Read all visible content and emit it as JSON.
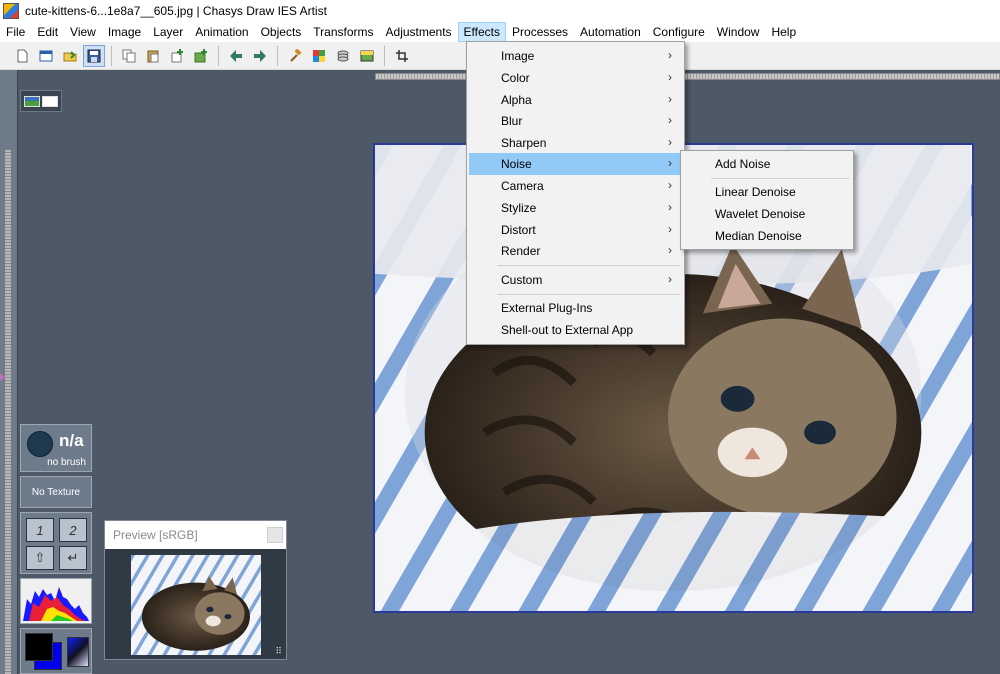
{
  "window": {
    "title": "cute-kittens-6...1e8a7__605.jpg | Chasys Draw IES Artist"
  },
  "menubar": [
    "File",
    "Edit",
    "View",
    "Image",
    "Layer",
    "Animation",
    "Objects",
    "Transforms",
    "Adjustments",
    "Effects",
    "Processes",
    "Automation",
    "Configure",
    "Window",
    "Help"
  ],
  "toolbar": {
    "buttons": [
      "new-file-icon",
      "new-window-icon",
      "open-file-icon",
      "save-icon",
      "copy-icon",
      "paste-icon",
      "new-layer-icon",
      "add-layer-icon",
      "back-arrow-icon",
      "forward-arrow-icon",
      "hammer-icon",
      "color-grid-icon",
      "layers-icon",
      "image-icon",
      "crop-icon"
    ]
  },
  "effects_menu": {
    "items": [
      {
        "label": "Image",
        "submenu": true
      },
      {
        "label": "Color",
        "submenu": true
      },
      {
        "label": "Alpha",
        "submenu": true
      },
      {
        "label": "Blur",
        "submenu": true
      },
      {
        "label": "Sharpen",
        "submenu": true
      },
      {
        "label": "Noise",
        "submenu": true,
        "highlighted": true
      },
      {
        "label": "Camera",
        "submenu": true
      },
      {
        "label": "Stylize",
        "submenu": true
      },
      {
        "label": "Distort",
        "submenu": true
      },
      {
        "label": "Render",
        "submenu": true
      },
      {
        "label": "Custom",
        "submenu": true
      },
      {
        "label": "External Plug-Ins",
        "submenu": false
      },
      {
        "label": "Shell-out to External App",
        "submenu": false
      }
    ]
  },
  "noise_menu": {
    "items": [
      "Add Noise",
      "Linear Denoise",
      "Wavelet Denoise",
      "Median Denoise"
    ]
  },
  "brush_panel": {
    "value": "n/a",
    "caption": "no brush"
  },
  "texture_panel": {
    "label": "No Texture"
  },
  "pad_panel": {
    "btn1": "1",
    "btn2": "2",
    "btn3": "⇧",
    "btn4": "↵"
  },
  "preview": {
    "title": "Preview [sRGB]"
  },
  "colors": {
    "workspace": "#4d5966",
    "menu_highlight": "#91c9f7",
    "canvas_border": "#2b3a9a",
    "foreground": "#000000",
    "background": "#0000ee"
  }
}
